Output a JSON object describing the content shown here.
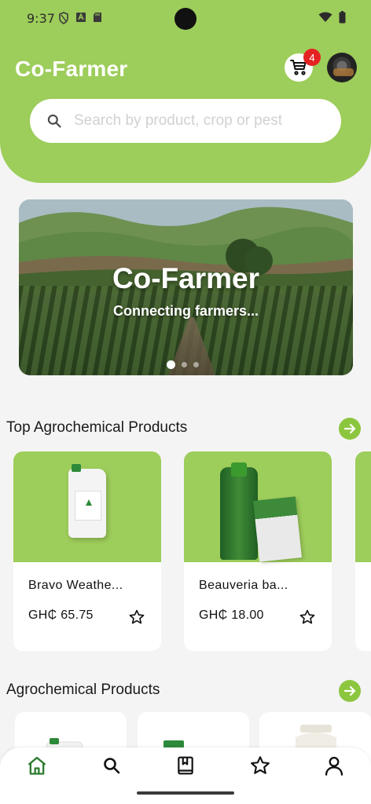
{
  "status_bar": {
    "time": "9:37"
  },
  "header": {
    "app_title": "Co-Farmer",
    "cart_count": "4",
    "search_placeholder": "Search by product, crop or pest"
  },
  "banner": {
    "title": "Co-Farmer",
    "subtitle": "Connecting farmers...",
    "slide_count": 3,
    "active_slide": 1
  },
  "sections": {
    "top_products": {
      "title": "Top Agrochemical Products",
      "products": [
        {
          "name": "Bravo Weathe...",
          "price": "GH₵ 65.75"
        },
        {
          "name": "Beauveria ba...",
          "price": "GH₵ 18.00"
        }
      ]
    },
    "products": {
      "title": "Agrochemical Products"
    }
  },
  "bottom_nav": {
    "items": [
      "home-icon",
      "search-icon",
      "book-icon",
      "star-icon",
      "profile-icon"
    ],
    "active": "home-icon"
  },
  "colors": {
    "brand_green": "#9dcd5a",
    "accent_green": "#8cc63f",
    "active_nav": "#2e7d32",
    "badge_red": "#e52222"
  }
}
